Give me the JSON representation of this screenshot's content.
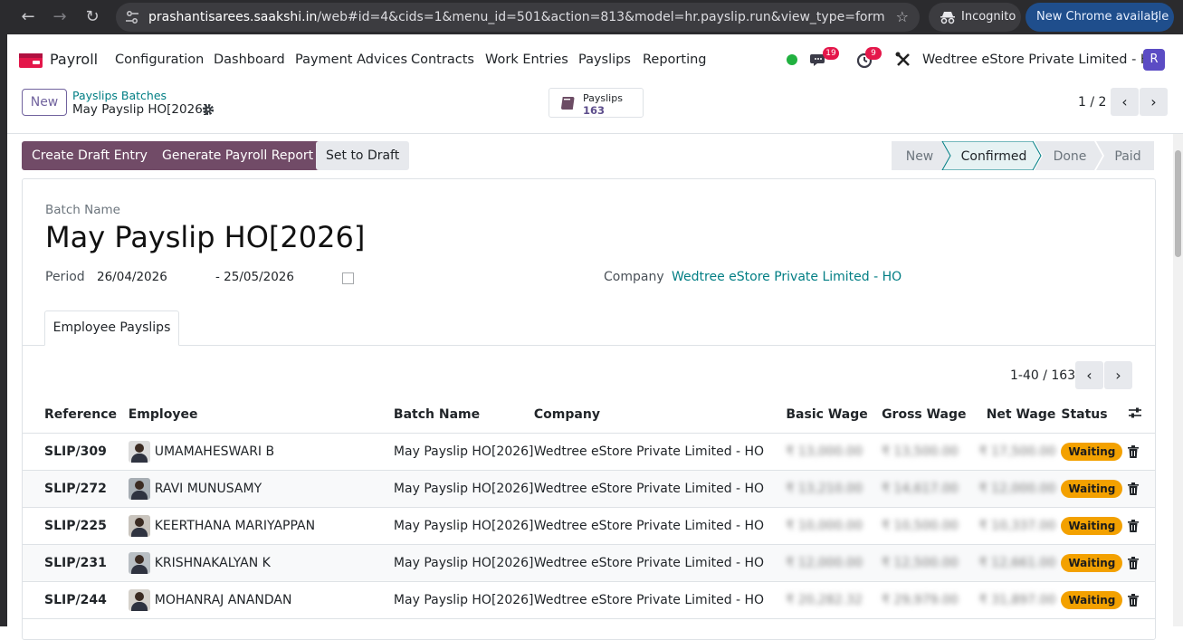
{
  "browser": {
    "url_host": "prashantisarees.saakshi.in",
    "url_path": "/web#id=4&cids=1&menu_id=501&action=813&model=hr.payslip.run&view_type=form",
    "incognito_label": "Incognito",
    "update_label": "New Chrome available"
  },
  "navbar": {
    "app_name": "Payroll",
    "menu": [
      "Configuration",
      "Dashboard",
      "Payment Advices",
      "Contracts",
      "Work Entries",
      "Payslips",
      "Reporting"
    ],
    "messages_badge": "19",
    "activities_badge": "9",
    "company": "Wedtree eStore Private Limited - HO",
    "avatar_initial": "R"
  },
  "control_panel": {
    "new_label": "New",
    "breadcrumb_parent": "Payslips Batches",
    "breadcrumb_current": "May Payslip HO[2026]",
    "smart_button_label": "Payslips",
    "smart_button_value": "163",
    "pager": "1 / 2"
  },
  "statusbar": {
    "buttons": [
      "Create Draft Entry",
      "Generate Payroll Report",
      "Set to Draft"
    ],
    "stages": [
      "New",
      "Confirmed",
      "Done",
      "Paid"
    ],
    "active_stage": "Confirmed"
  },
  "form": {
    "batch_name_label": "Batch Name",
    "batch_name": "May Payslip HO[2026]",
    "period_label": "Period",
    "period_start": "26/04/2026",
    "period_end": "- 25/05/2026",
    "company_label": "Company",
    "company_value": "Wedtree eStore Private Limited - HO",
    "tab_label": "Employee Payslips",
    "list_pager": "1-40 / 163",
    "columns": [
      "Reference",
      "Employee",
      "Batch Name",
      "Company",
      "Basic Wage",
      "Gross Wage",
      "Net Wage",
      "Status"
    ],
    "rows": [
      {
        "ref": "SLIP/309",
        "employee": "UMAMAHESWARI B",
        "batch": "May Payslip HO[2026]",
        "company": "Wedtree eStore Private Limited - HO",
        "basic": "₹ 13,000.00",
        "gross": "₹ 13,500.00",
        "net": "₹ 17,500.00",
        "status": "Waiting"
      },
      {
        "ref": "SLIP/272",
        "employee": "RAVI MUNUSAMY",
        "batch": "May Payslip HO[2026]",
        "company": "Wedtree eStore Private Limited - HO",
        "basic": "₹ 13,210.00",
        "gross": "₹ 14,617.00",
        "net": "₹ 12,000.00",
        "status": "Waiting"
      },
      {
        "ref": "SLIP/225",
        "employee": "KEERTHANA MARIYAPPAN",
        "batch": "May Payslip HO[2026]",
        "company": "Wedtree eStore Private Limited - HO",
        "basic": "₹ 10,000.00",
        "gross": "₹ 10,500.00",
        "net": "₹ 10,337.00",
        "status": "Waiting"
      },
      {
        "ref": "SLIP/231",
        "employee": "KRISHNAKALYAN K",
        "batch": "May Payslip HO[2026]",
        "company": "Wedtree eStore Private Limited - HO",
        "basic": "₹ 12,000.00",
        "gross": "₹ 12,500.00",
        "net": "₹ 12,661.00",
        "status": "Waiting"
      },
      {
        "ref": "SLIP/244",
        "employee": "MOHANRAJ ANANDAN",
        "batch": "May Payslip HO[2026]",
        "company": "Wedtree eStore Private Limited - HO",
        "basic": "₹ 20,282.32",
        "gross": "₹ 29,979.00",
        "net": "₹ 31,897.00",
        "status": "Waiting"
      }
    ]
  },
  "colors": {
    "primary": "#714b67",
    "link": "#017e84",
    "status_waiting": "#f3a100",
    "notification_badge": "#e4174a"
  }
}
